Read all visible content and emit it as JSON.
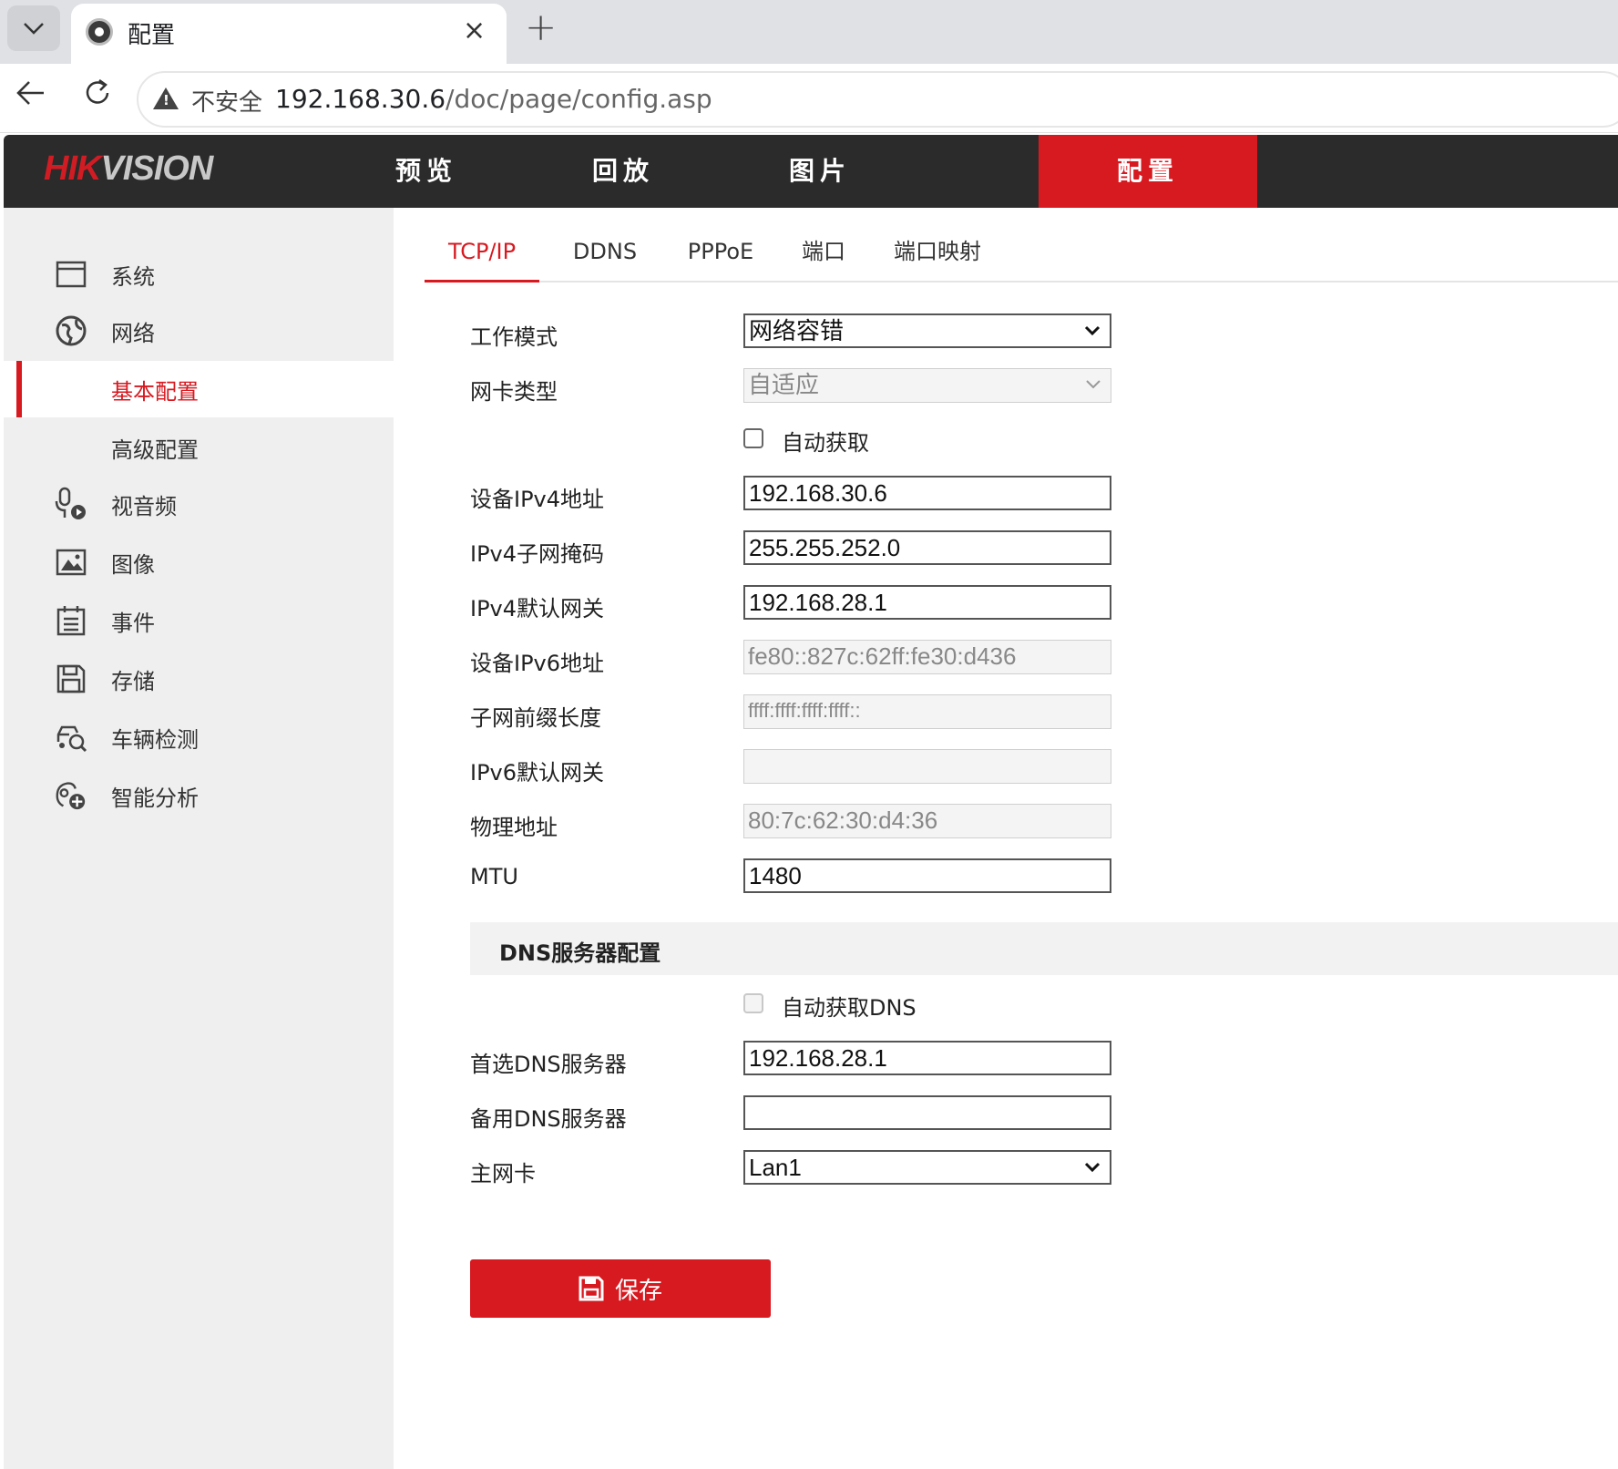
{
  "browser": {
    "tab_title": "配置",
    "tab_close": "×",
    "new_tab": "+",
    "insecure_label": "不安全",
    "url_host": "192.168.30.6",
    "url_path": "/doc/page/config.asp"
  },
  "header": {
    "logo_red": "HIK",
    "logo_gray": "VISION",
    "nav": [
      {
        "label": "预览"
      },
      {
        "label": "回放"
      },
      {
        "label": "图片"
      },
      {
        "label": "配置"
      }
    ],
    "active_color": "#d71920"
  },
  "sidebar": {
    "items": [
      {
        "label": "系统",
        "icon": "window-icon"
      },
      {
        "label": "网络",
        "icon": "globe-icon"
      },
      {
        "label": "基本配置"
      },
      {
        "label": "高级配置"
      },
      {
        "label": "视音频",
        "icon": "microphone-icon"
      },
      {
        "label": "图像",
        "icon": "image-icon"
      },
      {
        "label": "事件",
        "icon": "calendar-icon"
      },
      {
        "label": "存储",
        "icon": "disk-icon"
      },
      {
        "label": "车辆检测",
        "icon": "car-search-icon"
      },
      {
        "label": "智能分析",
        "icon": "analysis-icon"
      }
    ]
  },
  "tabs": [
    {
      "label": "TCP/IP"
    },
    {
      "label": "DDNS"
    },
    {
      "label": "PPPoE"
    },
    {
      "label": "端口"
    },
    {
      "label": "端口映射"
    }
  ],
  "form": {
    "work_mode": {
      "label": "工作模式",
      "value": "网络容错"
    },
    "nic_type": {
      "label": "网卡类型",
      "value": "自适应"
    },
    "dhcp": {
      "label": "自动获取"
    },
    "ipv4_address": {
      "label": "设备IPv4地址",
      "value": "192.168.30.6"
    },
    "ipv4_mask": {
      "label": "IPv4子网掩码",
      "value": "255.255.252.0"
    },
    "ipv4_gateway": {
      "label": "IPv4默认网关",
      "value": "192.168.28.1"
    },
    "ipv6_address": {
      "label": "设备IPv6地址",
      "value": "fe80::827c:62ff:fe30:d436"
    },
    "ipv6_prefix": {
      "label": "子网前缀长度",
      "value": "ffff:ffff:ffff:ffff::"
    },
    "ipv6_gateway": {
      "label": "IPv6默认网关",
      "value": ""
    },
    "mac": {
      "label": "物理地址",
      "value": "80:7c:62:30:d4:36"
    },
    "mtu": {
      "label": "MTU",
      "value": "1480"
    }
  },
  "dns": {
    "section_title": "DNS服务器配置",
    "auto_dns": {
      "label": "自动获取DNS"
    },
    "preferred": {
      "label": "首选DNS服务器",
      "value": "192.168.28.1"
    },
    "alternate": {
      "label": "备用DNS服务器",
      "value": ""
    },
    "main_nic": {
      "label": "主网卡",
      "value": "Lan1"
    }
  },
  "save_label": "保存"
}
